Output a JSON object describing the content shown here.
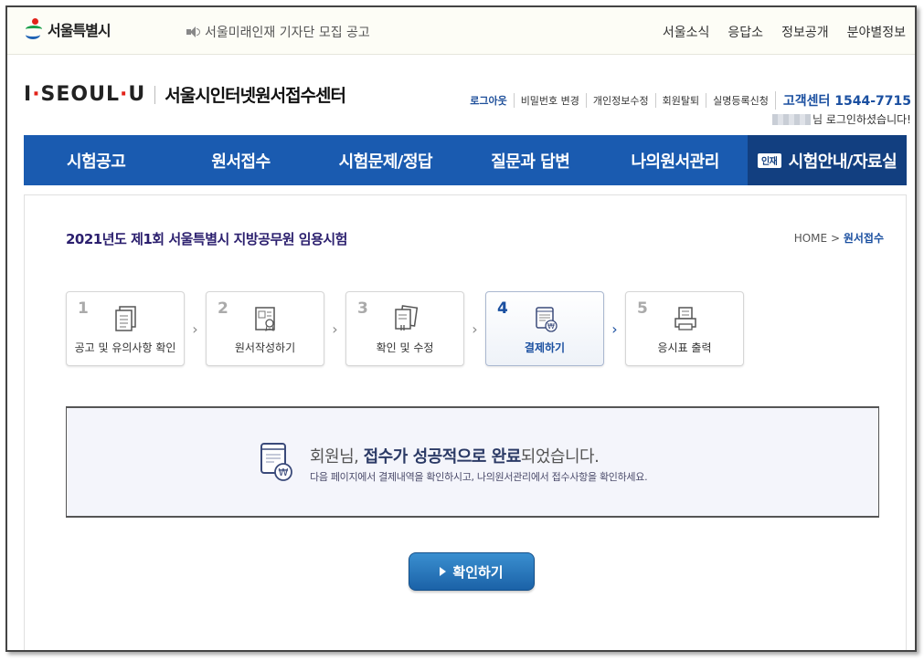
{
  "utility": {
    "logo_text": "서울특별시",
    "notice": "서울미래인재 기자단 모집 공고",
    "links": [
      "서울소식",
      "응답소",
      "정보공개",
      "분야별정보"
    ]
  },
  "header": {
    "brand_logo": "I·SEOUL·U",
    "center_name": "서울시인터넷원서접수센터",
    "account_links": [
      "로그아웃",
      "비밀번호 변경",
      "개인정보수정",
      "회원탈퇴",
      "실명등록신청"
    ],
    "call_center": "고객센터 1544-7715",
    "welcome_suffix": "님 로그인하셨습니다!"
  },
  "nav": {
    "items": [
      "시험공고",
      "원서접수",
      "시험문제/정답",
      "질문과 답변",
      "나의원서관리"
    ],
    "badge": "인재",
    "last_item": "시험안내/자료실"
  },
  "page": {
    "exam_title": "2021년도 제1회 서울특별시 지방공무원 임용시험",
    "breadcrumb_home": "HOME",
    "breadcrumb_sep": ">",
    "breadcrumb_current": "원서접수"
  },
  "steps": [
    {
      "num": "1",
      "label": "공고 및 유의사항 확인",
      "icon": "document-icon"
    },
    {
      "num": "2",
      "label": "원서작성하기",
      "icon": "id-card-icon"
    },
    {
      "num": "3",
      "label": "확인 및 수정",
      "icon": "papers-check-icon"
    },
    {
      "num": "4",
      "label": "결제하기",
      "icon": "payment-icon"
    },
    {
      "num": "5",
      "label": "응시표 출력",
      "icon": "printer-icon"
    }
  ],
  "active_step": "4",
  "completion": {
    "prefix": "회원님, ",
    "emphasis": "접수가 성공적으로 완료",
    "suffix": "되었습니다.",
    "sub": "다음 페이지에서 결제내역을 확인하시고, 나의원서관리에서 접수사항을 확인하세요."
  },
  "confirm_button": "확인하기",
  "colors": {
    "nav_blue": "#1a5bb0",
    "nav_dark": "#123f80",
    "accent": "#1a4fa0",
    "logo_red": "#e2231a"
  }
}
